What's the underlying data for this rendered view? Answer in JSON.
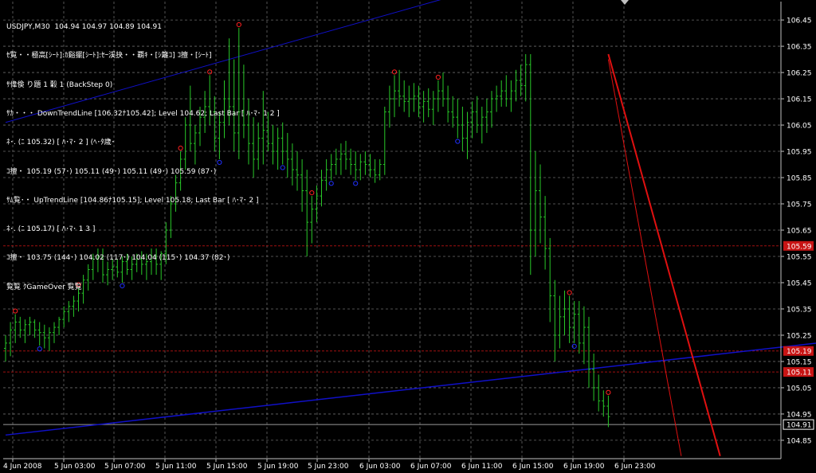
{
  "header": {
    "symbol_line": "USDJPY,M30  104.94 104.97 104.89 104.91",
    "info_lines": [
      "ｾ覧・・極高[ｼｰﾄ]:ｶ谿擺[ｼｰﾄ]:ｾｰ渓抉・・覇ｷ・[ｼ籬ｺ] ｺ擅・[ｼｰﾄ]",
      "ｻ偉倹 り題 1 轂 1 (BackStep 0)",
      "ｻｶ・・・ DownTrendLine [106.32ﾅ105.42]; Level 104.62; Last Bar [ ﾊ･ﾏ･ 1 2 ]",
      "ﾈ･. (ﾆ 105.32) [ ﾊ･ﾏ･ 2 ] (ﾍ･ﾀ歳･",
      "ｺ擅・ 105.19 (57･) 105.11 (49･) 105.11 (49･) 105.59 (87･)",
      "ｻﾑ覧･・ UpTrendLine [104.86ﾅ105.15]; Level 105.18; Last Bar [ ﾊ･ﾏ･ 2 ]",
      "ﾈ･. (ﾆ 105.17) [ ﾊ･ﾏ･ 1 3 ]",
      "ｺ擅・ 103.75 (144･) 104.02 (117･) 104.04 (115･) 104.37 (82･)",
      "覧覧 ｸGameOver 覧覧"
    ]
  },
  "chart_data": {
    "type": "bar",
    "title": "USDJPY,M30",
    "ylim": [
      104.78,
      106.52
    ],
    "y_ticks": [
      "106.45",
      "106.35",
      "106.25",
      "106.15",
      "106.05",
      "105.95",
      "105.85",
      "105.75",
      "105.65",
      "105.55",
      "105.45",
      "105.35",
      "105.25",
      "105.15",
      "105.05",
      "104.95",
      "104.85"
    ],
    "x_ticks": [
      "4 Jun 2008",
      "5 Jun 03:00",
      "5 Jun 07:00",
      "5 Jun 11:00",
      "5 Jun 15:00",
      "5 Jun 19:00",
      "5 Jun 23:00",
      "6 Jun 03:00",
      "6 Jun 07:00",
      "6 Jun 11:00",
      "6 Jun 15:00",
      "6 Jun 19:00",
      "6 Jun 23:00"
    ],
    "price_tags": [
      {
        "label": "105.59",
        "value": 105.59,
        "color": "#c81414"
      },
      {
        "label": "105.19",
        "value": 105.19,
        "color": "#c81414"
      },
      {
        "label": "105.11",
        "value": 105.11,
        "color": "#c81414"
      },
      {
        "label": "104.91",
        "value": 104.91,
        "color": "#000000"
      }
    ],
    "hlines": [
      {
        "value": 105.59,
        "color": "#a01010",
        "style": "dash"
      },
      {
        "value": 105.19,
        "color": "#a01010",
        "style": "dash"
      },
      {
        "value": 105.11,
        "color": "#a01010",
        "style": "dash"
      },
      {
        "value": 104.91,
        "color": "#9a9a9a",
        "style": "solid"
      }
    ],
    "trend_lines": [
      {
        "name": "UpTrendLine",
        "color": "#1010c8",
        "from": [
          0,
          104.87
        ],
        "to": [
          186,
          105.26
        ],
        "width": 1.5
      },
      {
        "name": "UpTrendLine",
        "color": "#1010c8",
        "from": [
          0,
          106.06
        ],
        "to": [
          90,
          106.53
        ],
        "width": 1
      },
      {
        "name": "DownTrendLine",
        "color": "#e01010",
        "from": [
          124,
          106.32
        ],
        "to": [
          147,
          104.79
        ],
        "width": 2
      },
      {
        "name": "DownTrendLine",
        "color": "#e01010",
        "from": [
          124,
          106.3
        ],
        "to": [
          139,
          104.79
        ],
        "width": 1
      }
    ],
    "series": [
      {
        "type": "ohlc",
        "color": "#28c828",
        "values": [
          [
            105.2,
            105.25,
            105.15,
            105.22
          ],
          [
            105.22,
            105.3,
            105.17,
            105.27
          ],
          [
            105.27,
            105.33,
            105.22,
            105.3
          ],
          [
            105.3,
            105.32,
            105.24,
            105.27
          ],
          [
            105.27,
            105.31,
            105.22,
            105.29
          ],
          [
            105.29,
            105.32,
            105.25,
            105.3
          ],
          [
            105.3,
            105.31,
            105.24,
            105.27
          ],
          [
            105.27,
            105.3,
            105.21,
            105.26
          ],
          [
            105.26,
            105.29,
            105.2,
            105.24
          ],
          [
            105.24,
            105.28,
            105.19,
            105.26
          ],
          [
            105.26,
            105.3,
            105.22,
            105.28
          ],
          [
            105.28,
            105.32,
            105.25,
            105.31
          ],
          [
            105.31,
            105.36,
            105.28,
            105.34
          ],
          [
            105.34,
            105.38,
            105.3,
            105.36
          ],
          [
            105.36,
            105.4,
            105.32,
            105.38
          ],
          [
            105.38,
            105.43,
            105.34,
            105.41
          ],
          [
            105.41,
            105.48,
            105.37,
            105.46
          ],
          [
            105.46,
            105.52,
            105.42,
            105.5
          ],
          [
            105.5,
            105.56,
            105.46,
            105.54
          ],
          [
            105.54,
            105.58,
            105.49,
            105.55
          ],
          [
            105.55,
            105.58,
            105.45,
            105.48
          ],
          [
            105.48,
            105.53,
            105.44,
            105.5
          ],
          [
            105.5,
            105.54,
            105.46,
            105.51
          ],
          [
            105.51,
            105.54,
            105.47,
            105.49
          ],
          [
            105.49,
            105.55,
            105.45,
            105.53
          ],
          [
            105.53,
            105.56,
            105.48,
            105.5
          ],
          [
            105.5,
            105.55,
            105.46,
            105.52
          ],
          [
            105.52,
            105.56,
            105.49,
            105.54
          ],
          [
            105.54,
            105.57,
            105.48,
            105.52
          ],
          [
            105.52,
            105.56,
            105.46,
            105.53
          ],
          [
            105.53,
            105.58,
            105.48,
            105.55
          ],
          [
            105.55,
            105.58,
            105.48,
            105.52
          ],
          [
            105.52,
            105.57,
            105.46,
            105.56
          ],
          [
            105.56,
            105.68,
            105.52,
            105.65
          ],
          [
            105.65,
            105.78,
            105.62,
            105.75
          ],
          [
            105.75,
            105.86,
            105.72,
            105.83
          ],
          [
            105.83,
            105.95,
            105.8,
            105.92
          ],
          [
            105.92,
            106.08,
            105.88,
            106.05
          ],
          [
            106.05,
            106.2,
            105.95,
            105.98
          ],
          [
            105.98,
            106.05,
            105.9,
            106.02
          ],
          [
            106.02,
            106.12,
            105.97,
            106.08
          ],
          [
            106.08,
            106.18,
            106.02,
            106.12
          ],
          [
            106.12,
            106.24,
            106.05,
            106.1
          ],
          [
            106.1,
            106.16,
            105.95,
            106.0
          ],
          [
            106.0,
            106.1,
            105.92,
            106.06
          ],
          [
            106.06,
            106.22,
            106.0,
            106.15
          ],
          [
            106.15,
            106.38,
            106.05,
            106.12
          ],
          [
            106.12,
            106.3,
            105.95,
            106.02
          ],
          [
            106.02,
            106.42,
            105.92,
            106.1
          ],
          [
            106.1,
            106.28,
            106.0,
            106.05
          ],
          [
            106.05,
            106.15,
            105.9,
            105.98
          ],
          [
            105.98,
            106.08,
            105.85,
            105.92
          ],
          [
            105.92,
            106.06,
            105.88,
            106.0
          ],
          [
            106.0,
            106.18,
            105.9,
            106.03
          ],
          [
            106.03,
            106.1,
            105.95,
            105.98
          ],
          [
            105.98,
            106.05,
            105.9,
            105.95
          ],
          [
            105.95,
            106.04,
            105.88,
            106.0
          ],
          [
            106.0,
            106.06,
            105.9,
            105.95
          ],
          [
            105.95,
            106.02,
            105.85,
            105.92
          ],
          [
            105.92,
            105.98,
            105.82,
            105.88
          ],
          [
            105.88,
            105.95,
            105.8,
            105.86
          ],
          [
            105.86,
            105.92,
            105.72,
            105.8
          ],
          [
            105.8,
            105.88,
            105.55,
            105.68
          ],
          [
            105.68,
            105.78,
            105.6,
            105.73
          ],
          [
            105.73,
            105.82,
            105.68,
            105.78
          ],
          [
            105.78,
            105.88,
            105.74,
            105.84
          ],
          [
            105.84,
            105.92,
            105.8,
            105.88
          ],
          [
            105.88,
            105.94,
            105.84,
            105.9
          ],
          [
            105.9,
            105.96,
            105.86,
            105.92
          ],
          [
            105.92,
            105.98,
            105.86,
            105.94
          ],
          [
            105.94,
            105.99,
            105.88,
            105.92
          ],
          [
            105.92,
            105.96,
            105.86,
            105.9
          ],
          [
            105.9,
            105.95,
            105.84,
            105.88
          ],
          [
            105.88,
            105.94,
            105.84,
            105.91
          ],
          [
            105.91,
            105.95,
            105.86,
            105.9
          ],
          [
            105.9,
            105.94,
            105.85,
            105.88
          ],
          [
            105.88,
            105.92,
            105.83,
            105.86
          ],
          [
            105.86,
            105.92,
            105.84,
            105.9
          ],
          [
            105.9,
            106.12,
            105.86,
            106.1
          ],
          [
            106.1,
            106.2,
            106.04,
            106.15
          ],
          [
            106.15,
            106.24,
            106.08,
            106.18
          ],
          [
            106.18,
            106.26,
            106.12,
            106.16
          ],
          [
            106.16,
            106.22,
            106.1,
            106.14
          ],
          [
            106.14,
            106.2,
            106.08,
            106.15
          ],
          [
            106.15,
            106.21,
            106.1,
            106.16
          ],
          [
            106.16,
            106.2,
            106.08,
            106.12
          ],
          [
            106.12,
            106.18,
            106.06,
            106.14
          ],
          [
            106.14,
            106.19,
            106.08,
            106.11
          ],
          [
            106.11,
            106.18,
            106.05,
            106.15
          ],
          [
            106.15,
            106.22,
            106.1,
            106.18
          ],
          [
            106.18,
            106.25,
            106.12,
            106.15
          ],
          [
            106.15,
            106.2,
            106.06,
            106.1
          ],
          [
            106.1,
            106.16,
            106.04,
            106.08
          ],
          [
            106.08,
            106.15,
            106.0,
            106.05
          ],
          [
            106.05,
            106.12,
            105.95,
            106.0
          ],
          [
            106.0,
            106.1,
            105.92,
            106.06
          ],
          [
            106.06,
            106.14,
            106.0,
            106.1
          ],
          [
            106.1,
            106.16,
            106.02,
            106.05
          ],
          [
            106.05,
            106.12,
            105.98,
            106.08
          ],
          [
            106.08,
            106.15,
            106.02,
            106.1
          ],
          [
            106.1,
            106.18,
            106.04,
            106.15
          ],
          [
            106.15,
            106.2,
            106.1,
            106.16
          ],
          [
            106.16,
            106.22,
            106.12,
            106.18
          ],
          [
            106.18,
            106.24,
            106.12,
            106.15
          ],
          [
            106.15,
            106.22,
            106.1,
            106.18
          ],
          [
            106.18,
            106.26,
            106.14,
            106.22
          ],
          [
            106.22,
            106.28,
            106.16,
            106.2
          ],
          [
            106.2,
            106.32,
            106.14,
            106.28
          ],
          [
            106.28,
            106.32,
            105.48,
            105.65
          ],
          [
            105.65,
            105.95,
            105.55,
            105.8
          ],
          [
            105.8,
            105.9,
            105.6,
            105.7
          ],
          [
            105.7,
            105.78,
            105.5,
            105.58
          ],
          [
            105.58,
            105.62,
            105.3,
            105.4
          ],
          [
            105.4,
            105.46,
            105.15,
            105.25
          ],
          [
            105.25,
            105.4,
            105.2,
            105.32
          ],
          [
            105.32,
            105.42,
            105.25,
            105.35
          ],
          [
            105.35,
            105.4,
            105.22,
            105.28
          ],
          [
            105.28,
            105.38,
            105.22,
            105.33
          ],
          [
            105.33,
            105.38,
            105.18,
            105.22
          ],
          [
            105.22,
            105.36,
            105.14,
            105.28
          ],
          [
            105.28,
            105.32,
            105.05,
            105.12
          ],
          [
            105.12,
            105.18,
            105.0,
            105.05
          ],
          [
            105.05,
            105.1,
            104.96,
            105.0
          ],
          [
            105.0,
            105.04,
            104.94,
            104.98
          ],
          [
            104.98,
            105.02,
            104.9,
            104.94
          ]
        ]
      }
    ],
    "zigzag_highs": [
      2,
      15,
      36,
      42,
      48,
      63,
      80,
      89,
      124,
      116
    ],
    "zigzag_lows": [
      7,
      24,
      44,
      57,
      67,
      72,
      93,
      117
    ],
    "last_x_label": "6 Jun 23:00"
  }
}
